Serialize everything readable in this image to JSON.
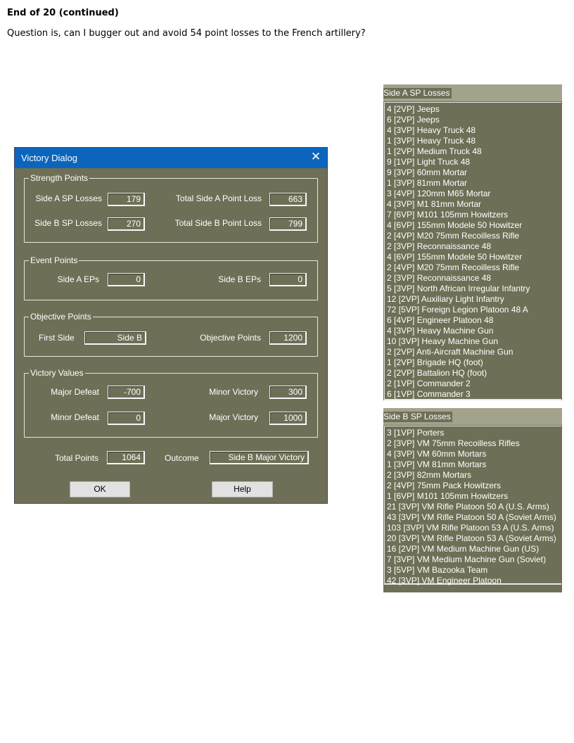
{
  "doc": {
    "heading": "End of 20 (continued)",
    "question": "Question is, can I bugger out and avoid 54 point losses to the French artillery?"
  },
  "dialog": {
    "title": "Victory Dialog",
    "close_icon": "close-icon",
    "strength": {
      "legend": "Strength Points",
      "side_a_sp_label": "Side A SP Losses",
      "side_a_sp_value": "179",
      "total_a_label": "Total Side A Point Loss",
      "total_a_value": "663",
      "side_b_sp_label": "Side B SP Losses",
      "side_b_sp_value": "270",
      "total_b_label": "Total Side B Point Loss",
      "total_b_value": "799"
    },
    "events": {
      "legend": "Event Points",
      "side_a_label": "Side A EPs",
      "side_a_value": "0",
      "side_b_label": "Side B EPs",
      "side_b_value": "0"
    },
    "objectives": {
      "legend": "Objective Points",
      "first_side_label": "First Side",
      "first_side_value": "Side B",
      "points_label": "Objective Points",
      "points_value": "1200"
    },
    "victory": {
      "legend": "Victory Values",
      "major_defeat_label": "Major Defeat",
      "major_defeat_value": "-700",
      "minor_victory_label": "Minor Victory",
      "minor_victory_value": "300",
      "minor_defeat_label": "Minor Defeat",
      "minor_defeat_value": "0",
      "major_victory_label": "Major Victory",
      "major_victory_value": "1000"
    },
    "total_label": "Total Points",
    "total_value": "1064",
    "outcome_label": "Outcome",
    "outcome_value": "Side B Major Victory",
    "ok_label": "OK",
    "help_label": "Help"
  },
  "side_a_losses": {
    "title": "Side A SP Losses",
    "items": [
      "4 [2VP] Jeeps",
      "6 [2VP] Jeeps",
      "4 [3VP] Heavy Truck 48",
      "1 [3VP] Heavy Truck 48",
      "1 [2VP] Medium Truck 48",
      "9 [1VP] Light Truck 48",
      "9 [3VP] 60mm Mortar",
      "1 [3VP] 81mm Mortar",
      "3 [4VP] 120mm M65 Mortar",
      "4 [3VP] M1 81mm Mortar",
      "7 [6VP] M101 105mm Howitzers",
      "4 [6VP] 155mm Modele 50 Howitzer",
      "2 [4VP] M20 75mm Recoilless Rifle",
      "2 [3VP] Reconnaissance 48",
      "4 [6VP] 155mm Modele 50 Howitzer",
      "2 [4VP] M20 75mm Recoilless Rifle",
      "2 [3VP] Reconnaissance 48",
      "5 [3VP] North African Irregular Infantry",
      "12 [2VP] Auxiliary Light Infantry",
      "72 [5VP] Foreign Legion Platoon 48 A",
      "6 [4VP] Engineer Platoon 48",
      "4 [3VP] Heavy Machine Gun",
      "10 [3VP] Heavy Machine Gun",
      "2 [2VP] Anti-Aircraft Machine Gun",
      "1 [2VP] Brigade HQ (foot)",
      "2 [2VP] Battalion HQ (foot)",
      "2 [1VP] Commander 2",
      "6 [1VP] Commander 3"
    ]
  },
  "side_b_losses": {
    "title": "Side B SP Losses",
    "items": [
      "3 [1VP] Porters",
      "2 [3VP] VM 75mm Recoilless Rifles",
      "4 [3VP] VM 60mm Mortars",
      "1 [3VP] VM 81mm Mortars",
      "2 [3VP] 82mm Mortars",
      "2 [4VP] 75mm Pack Howitzers",
      "1 [6VP] M101 105mm Howitzers",
      "21 [3VP] VM Rifle Platoon 50 A (U.S. Arms)",
      "43 [3VP] VM Rifle Platoon 50 A (Soviet Arms)",
      "103 [3VP] VM Rifle Platoon 53 A (U.S. Arms)",
      "20 [3VP] VM Rifle Platoon 53 A (Soviet Arms)",
      "16 [2VP] VM Medium Machine Gun (US)",
      "7 [3VP] VM Medium Machine Gun (Soviet)",
      "3 [5VP] VM Bazooka Team",
      "42 [3VP] VM Engineer Platoon"
    ]
  }
}
